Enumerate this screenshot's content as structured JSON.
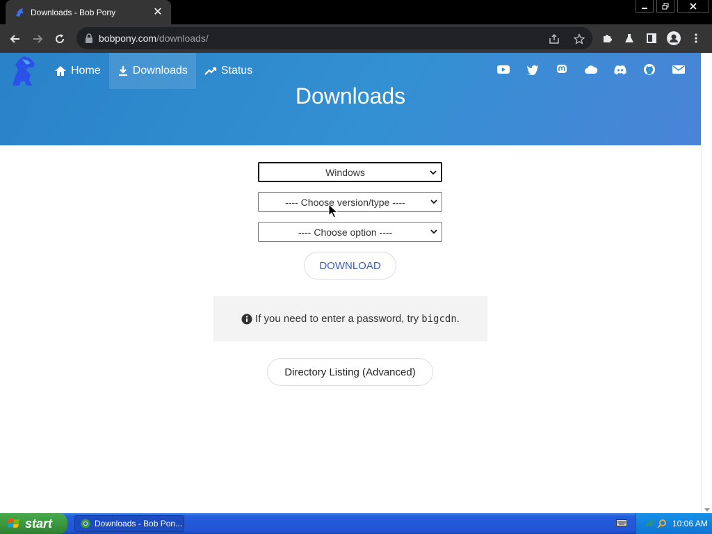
{
  "browser": {
    "tab_title": "Downloads - Bob Pony",
    "tab_close": "✕",
    "url_domain": "bobpony.com",
    "url_path": "/downloads/"
  },
  "site": {
    "nav": [
      {
        "label": "Home",
        "icon": "home-icon"
      },
      {
        "label": "Downloads",
        "icon": "download-icon"
      },
      {
        "label": "Status",
        "icon": "trending-up-icon"
      }
    ],
    "social_icons": [
      "youtube-icon",
      "twitter-icon",
      "mastodon-icon",
      "cloud-icon",
      "discord-icon",
      "github-icon",
      "mail-icon"
    ],
    "page_title": "Downloads",
    "accent": "#3390d2"
  },
  "form": {
    "os_select": "Windows",
    "version_select": "---- Choose version/type ----",
    "option_select": "---- Choose option ----",
    "download_label": "DOWNLOAD"
  },
  "notice": {
    "text_before": "If you need to enter a password, try",
    "code": "bigcdn",
    "text_after": "."
  },
  "directory_listing_label": "Directory Listing (Advanced)",
  "taskbar": {
    "start_label": "start",
    "task_label": "Downloads - Bob Pon...",
    "clock": "10:06 AM"
  }
}
